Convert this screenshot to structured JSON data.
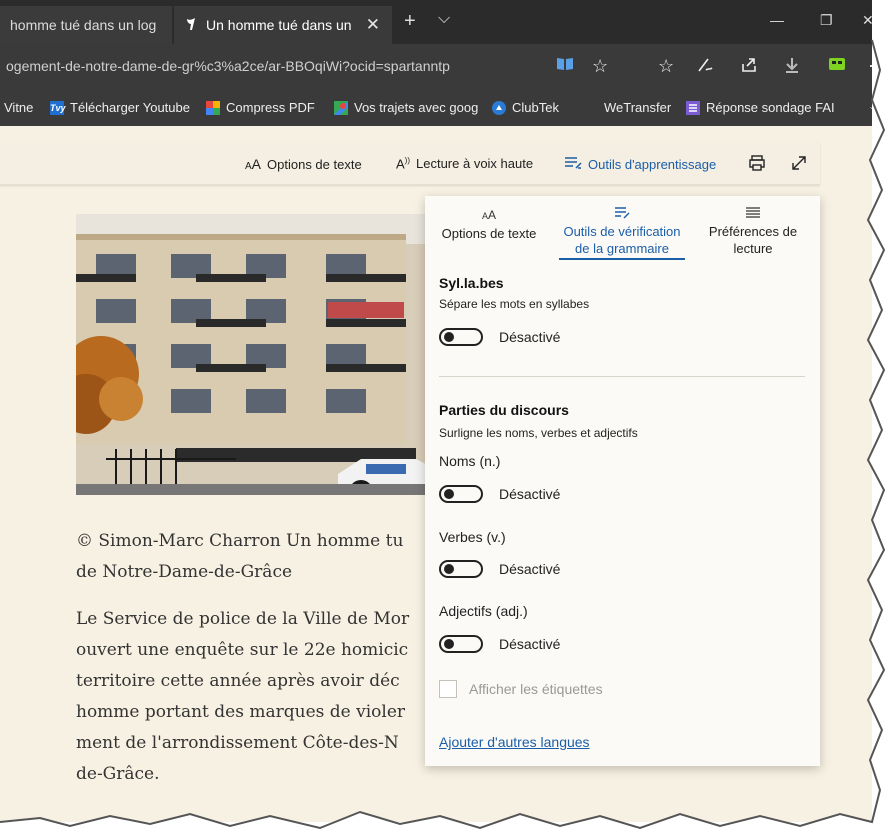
{
  "tabs": [
    {
      "label": "homme tué dans un log"
    },
    {
      "label": "Un homme tué dans un",
      "active": true
    }
  ],
  "tab_controls": {
    "new_tab": "+",
    "menu": "⌵",
    "close_tab": "✕"
  },
  "window_controls": {
    "minimize": "—",
    "restore": "❐",
    "close": "✕"
  },
  "address": {
    "url": "ogement-de-notre-dame-de-gr%c3%a2ce/ar-BBOqiWi?ocid=spartanntp"
  },
  "bookmarks": [
    {
      "label": "Vitne"
    },
    {
      "label": "Télécharger Youtube",
      "icon_text": "Tvy"
    },
    {
      "label": "Compress PDF"
    },
    {
      "label": "Vos trajets avec goog"
    },
    {
      "label": "ClubTek"
    },
    {
      "label": "WeTransfer"
    },
    {
      "label": "Réponse sondage FAI"
    }
  ],
  "reader_toolbar": {
    "text_options": "Options de texte",
    "read_aloud": "Lecture à voix haute",
    "learning_tools": "Outils d'apprentissage"
  },
  "article": {
    "caption_lines": [
      "© Simon-Marc Charron Un homme tu",
      "de Notre-Dame-de-Grâce"
    ],
    "paragraph_lines": [
      "Le Service de police de la Ville de Mor",
      "ouvert une enquête sur le 22e homicic",
      "territoire cette année après avoir déc",
      "homme portant des marques de violer",
      "ment de l'arrondissement Côte-des-N",
      "de-Grâce."
    ]
  },
  "panel": {
    "tabs": [
      {
        "label_line1": "Options de texte",
        "label_line2": ""
      },
      {
        "label_line1": "Outils de vérification",
        "label_line2": "de la grammaire",
        "active": true
      },
      {
        "label_line1": "Préférences de",
        "label_line2": "lecture"
      }
    ],
    "syllables": {
      "title": "Syl.la.bes",
      "desc": "Sépare les mots en syllabes",
      "state": "Désactivé"
    },
    "parts_of_speech": {
      "title": "Parties du discours",
      "desc": "Surligne les noms, verbes et adjectifs"
    },
    "nouns": {
      "label": "Noms (n.)",
      "state": "Désactivé"
    },
    "verbs": {
      "label": "Verbes (v.)",
      "state": "Désactivé"
    },
    "adjectives": {
      "label": "Adjectifs (adj.)",
      "state": "Désactivé"
    },
    "show_labels": "Afficher les étiquettes",
    "add_languages": "Ajouter d'autres langues"
  }
}
